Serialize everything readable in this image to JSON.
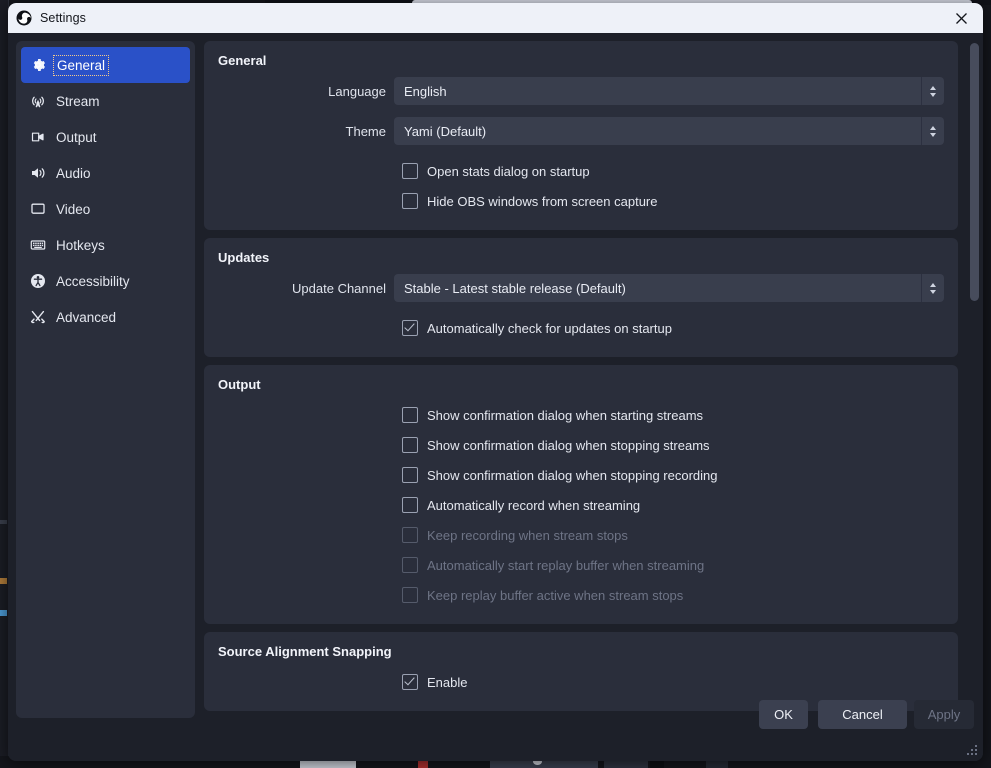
{
  "window": {
    "title": "Settings",
    "app_icon": "obs-logo-icon",
    "close_icon": "close-icon",
    "accent_color": "#2a51c8",
    "titlebar_bg": "#eef1f8",
    "dialog_bg": "#1d2029",
    "panel_bg": "#2a2e3b"
  },
  "sidebar": {
    "items": [
      {
        "label": "General",
        "icon": "gear-icon",
        "selected": true
      },
      {
        "label": "Stream",
        "icon": "broadcast-icon",
        "selected": false
      },
      {
        "label": "Output",
        "icon": "output-camera-icon",
        "selected": false
      },
      {
        "label": "Audio",
        "icon": "speaker-icon",
        "selected": false
      },
      {
        "label": "Video",
        "icon": "monitor-icon",
        "selected": false
      },
      {
        "label": "Hotkeys",
        "icon": "keyboard-icon",
        "selected": false
      },
      {
        "label": "Accessibility",
        "icon": "accessibility-icon",
        "selected": false
      },
      {
        "label": "Advanced",
        "icon": "tools-icon",
        "selected": false
      }
    ]
  },
  "groups": [
    {
      "title": "General",
      "rows": [
        {
          "type": "combo",
          "label": "Language",
          "value": "English"
        },
        {
          "type": "combo",
          "label": "Theme",
          "value": "Yami (Default)"
        },
        {
          "type": "check",
          "label": "Open stats dialog on startup",
          "checked": false,
          "disabled": false
        },
        {
          "type": "check",
          "label": "Hide OBS windows from screen capture",
          "checked": false,
          "disabled": false
        }
      ]
    },
    {
      "title": "Updates",
      "rows": [
        {
          "type": "combo",
          "label": "Update Channel",
          "value": "Stable - Latest stable release (Default)"
        },
        {
          "type": "check",
          "label": "Automatically check for updates on startup",
          "checked": true,
          "disabled": false
        }
      ]
    },
    {
      "title": "Output",
      "rows": [
        {
          "type": "check",
          "label": "Show confirmation dialog when starting streams",
          "checked": false,
          "disabled": false
        },
        {
          "type": "check",
          "label": "Show confirmation dialog when stopping streams",
          "checked": false,
          "disabled": false
        },
        {
          "type": "check",
          "label": "Show confirmation dialog when stopping recording",
          "checked": false,
          "disabled": false
        },
        {
          "type": "check",
          "label": "Automatically record when streaming",
          "checked": false,
          "disabled": false
        },
        {
          "type": "check",
          "label": "Keep recording when stream stops",
          "checked": false,
          "disabled": true
        },
        {
          "type": "check",
          "label": "Automatically start replay buffer when streaming",
          "checked": false,
          "disabled": true
        },
        {
          "type": "check",
          "label": "Keep replay buffer active when stream stops",
          "checked": false,
          "disabled": true
        }
      ]
    },
    {
      "title": "Source Alignment Snapping",
      "rows": [
        {
          "type": "check",
          "label": "Enable",
          "checked": true,
          "disabled": false
        }
      ]
    }
  ],
  "footer": {
    "ok_label": "OK",
    "cancel_label": "Cancel",
    "apply_label": "Apply",
    "apply_disabled": true
  }
}
